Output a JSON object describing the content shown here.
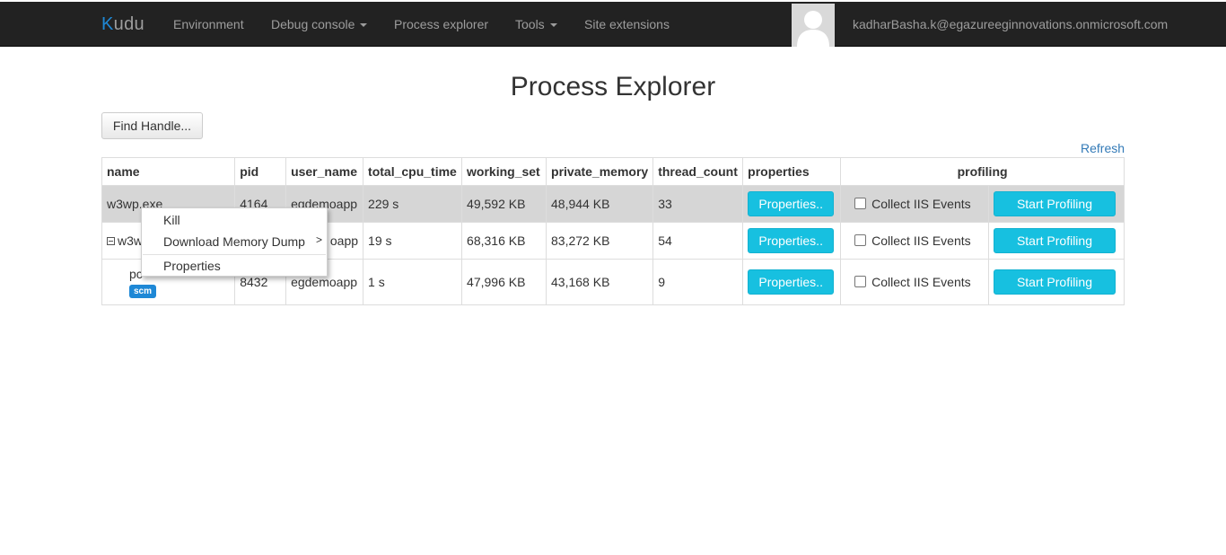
{
  "navbar": {
    "brand_k": "K",
    "brand_rest": "udu",
    "links": {
      "environment": "Environment",
      "debug_console": "Debug console",
      "process_explorer": "Process explorer",
      "tools": "Tools",
      "site_extensions": "Site extensions"
    },
    "user_email": "kadharBasha.k@egazureeginnovations.onmicrosoft.com"
  },
  "page": {
    "title": "Process Explorer",
    "find_handle_label": "Find Handle...",
    "refresh_label": "Refresh"
  },
  "table": {
    "headers": {
      "name": "name",
      "pid": "pid",
      "user_name": "user_name",
      "total_cpu_time": "total_cpu_time",
      "working_set": "working_set",
      "private_memory": "private_memory",
      "thread_count": "thread_count",
      "properties": "properties",
      "profiling": "profiling"
    },
    "rows": [
      {
        "name": "w3wp.exe",
        "pid": "4164",
        "user_name": "egdemoapp",
        "total_cpu_time": "229 s",
        "working_set": "49,592 KB",
        "private_memory": "48,944 KB",
        "thread_count": "33",
        "properties_button": "Properties..",
        "collect_label": "Collect IIS Events",
        "profiling_button": "Start Profiling"
      },
      {
        "name": "w3w",
        "pid": "",
        "user_name": "oapp",
        "total_cpu_time": "19 s",
        "working_set": "68,316 KB",
        "private_memory": "83,272 KB",
        "thread_count": "54",
        "properties_button": "Properties..",
        "collect_label": "Collect IIS Events",
        "profiling_button": "Start Profiling"
      },
      {
        "name": "pc",
        "badge": "scm",
        "pid": "8432",
        "user_name": "egdemoapp",
        "total_cpu_time": "1 s",
        "working_set": "47,996 KB",
        "private_memory": "43,168 KB",
        "thread_count": "9",
        "properties_button": "Properties..",
        "collect_label": "Collect IIS Events",
        "profiling_button": "Start Profiling"
      }
    ]
  },
  "context_menu": {
    "kill": "Kill",
    "download_memory_dump": "Download Memory Dump",
    "submenu_arrow": ">",
    "properties": "Properties"
  },
  "colors": {
    "navbar_bg": "#222222",
    "accent_button": "#17c0e0",
    "link": "#337ab7",
    "badge": "#1e88d6",
    "selected_row": "#d6d6d6"
  }
}
